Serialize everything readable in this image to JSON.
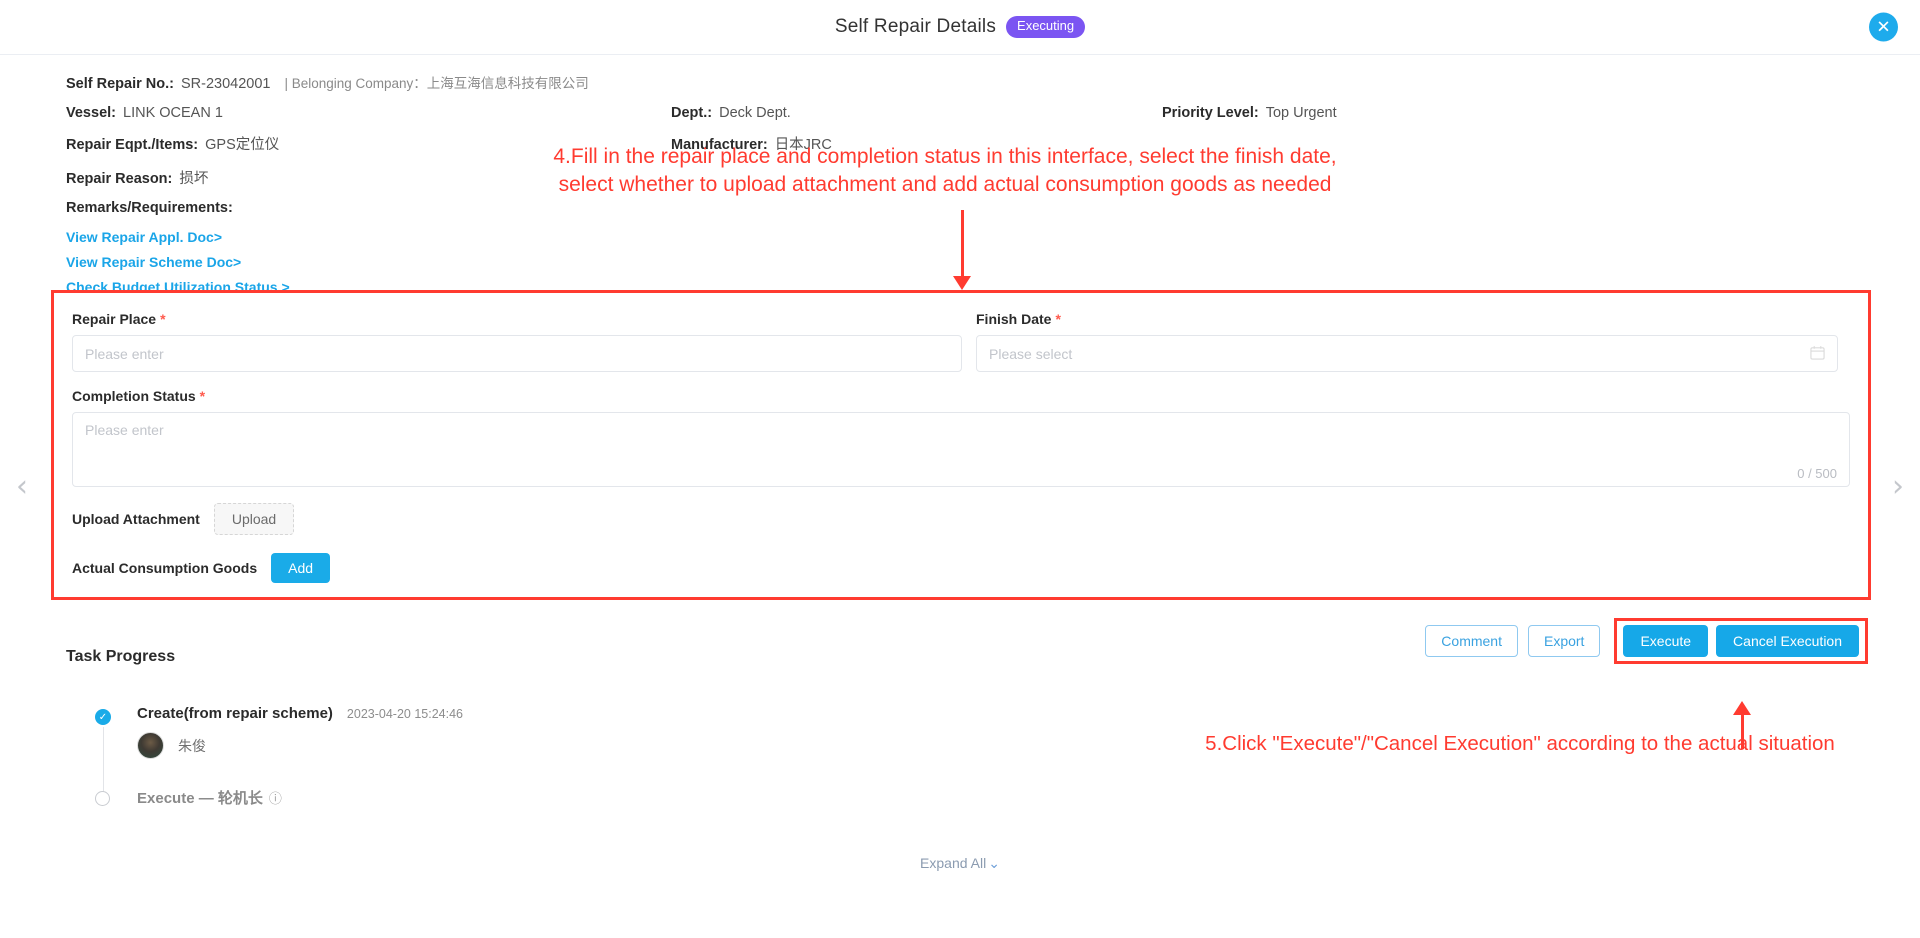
{
  "header": {
    "title": "Self Repair Details",
    "status": "Executing",
    "close_icon": "close-icon"
  },
  "info": {
    "repair_no_label": "Self Repair No.:",
    "repair_no_value": "SR-23042001",
    "belonging_company": "| Belonging Company：上海互海信息科技有限公司",
    "vessel_label": "Vessel:",
    "vessel_value": "LINK OCEAN 1",
    "dept_label": "Dept.:",
    "dept_value": "Deck Dept.",
    "priority_label": "Priority Level:",
    "priority_value": "Top Urgent",
    "eqpt_label": "Repair Eqpt./Items:",
    "eqpt_value": "GPS定位仪",
    "manufacturer_label": "Manufacturer:",
    "manufacturer_value": "日本JRC",
    "reason_label": "Repair Reason:",
    "reason_value": "损坏",
    "remarks_label": "Remarks/Requirements:",
    "links": [
      "View Repair Appl. Doc>",
      "View Repair Scheme Doc>",
      "Check Budget Utilization Status >"
    ]
  },
  "annotations": {
    "step4": "4.Fill in the repair place and completion status in this interface, select the finish date,\nselect whether to upload attachment and add actual consumption goods as needed",
    "step5": "5.Click \"Execute\"/\"Cancel Execution\" according to the actual situation"
  },
  "form": {
    "repair_place_label": "Repair Place",
    "repair_place_placeholder": "Please enter",
    "repair_place_value": "",
    "finish_date_label": "Finish Date",
    "finish_date_placeholder": "Please select",
    "finish_date_value": "",
    "completion_status_label": "Completion Status",
    "completion_status_placeholder": "Please enter",
    "completion_status_value": "",
    "counter": "0 / 500",
    "required_mark": "*",
    "upload_attachment_label": "Upload Attachment",
    "upload_button": "Upload",
    "consumption_goods_label": "Actual Consumption Goods",
    "add_button": "Add"
  },
  "actions": {
    "comment": "Comment",
    "export": "Export",
    "execute": "Execute",
    "cancel_execution": "Cancel Execution"
  },
  "task_progress": {
    "title": "Task Progress",
    "steps": [
      {
        "name": "Create(from repair scheme)",
        "time": "2023-04-20 15:24:46",
        "user": "朱俊",
        "state": "done"
      },
      {
        "name": "Execute — 轮机长",
        "time": "",
        "user": "",
        "state": "pending"
      }
    ],
    "expand_all": "Expand All"
  },
  "nav": {
    "prev_icon": "chevron-left-icon",
    "next_icon": "chevron-right-icon"
  },
  "colors": {
    "accent": "#16a8e8",
    "badge": "#7b55f2",
    "annotation": "#ff3b30",
    "link": "#1aa5e8"
  }
}
